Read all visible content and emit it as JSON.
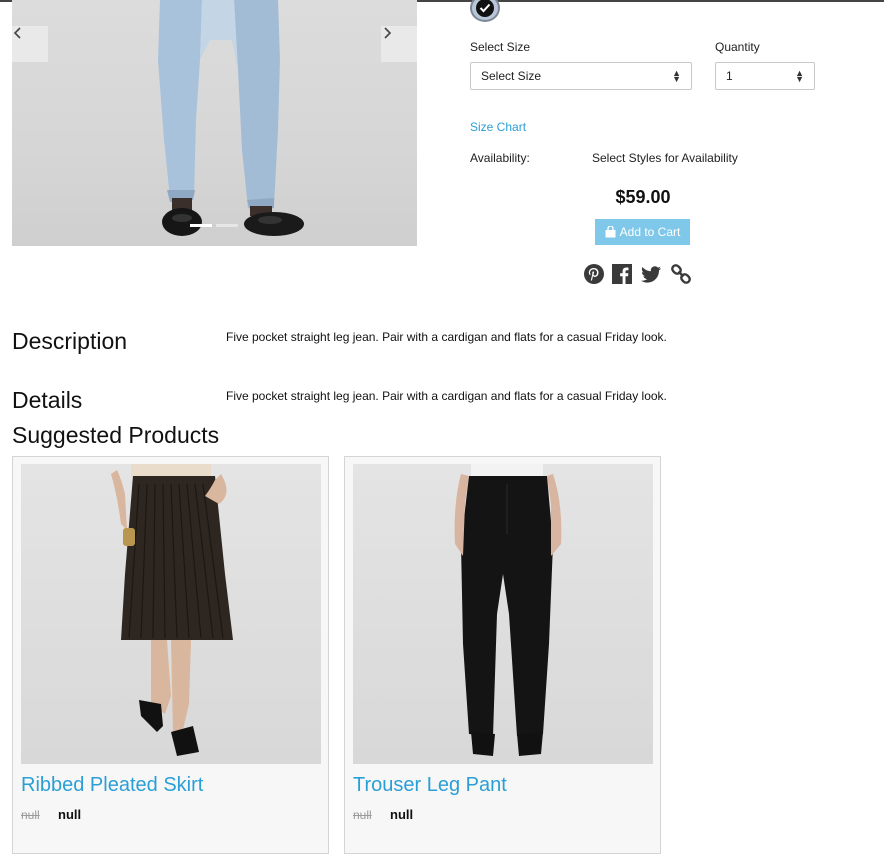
{
  "gallery": {
    "prev_icon": "chevron-left-icon",
    "next_icon": "chevron-right-icon",
    "slide_count": 2,
    "active_slide": 1
  },
  "product": {
    "swatch_color": "#b7c7d9",
    "size_label": "Select Size",
    "size_value": "Select Size",
    "quantity_label": "Quantity",
    "quantity_value": "1",
    "size_chart_link": "Size Chart",
    "availability_label": "Availability:",
    "availability_value": "Select Styles for Availability",
    "price": "$59.00",
    "add_to_cart": "Add to Cart",
    "accent_color": "#2a9fd6",
    "button_color": "#7fc8ea"
  },
  "social": [
    "pinterest-icon",
    "facebook-icon",
    "twitter-icon",
    "link-icon"
  ],
  "description": {
    "title": "Description",
    "text": "Five pocket straight leg jean. Pair with a cardigan and flats for a casual Friday look."
  },
  "details": {
    "title": "Details",
    "text": "Five pocket straight leg jean. Pair with a cardigan and flats for a casual Friday look."
  },
  "suggested": {
    "title": "Suggested Products",
    "items": [
      {
        "name": "Ribbed Pleated Skirt",
        "old_price": "null",
        "price": "null"
      },
      {
        "name": "Trouser Leg Pant",
        "old_price": "null",
        "price": "null"
      }
    ]
  }
}
